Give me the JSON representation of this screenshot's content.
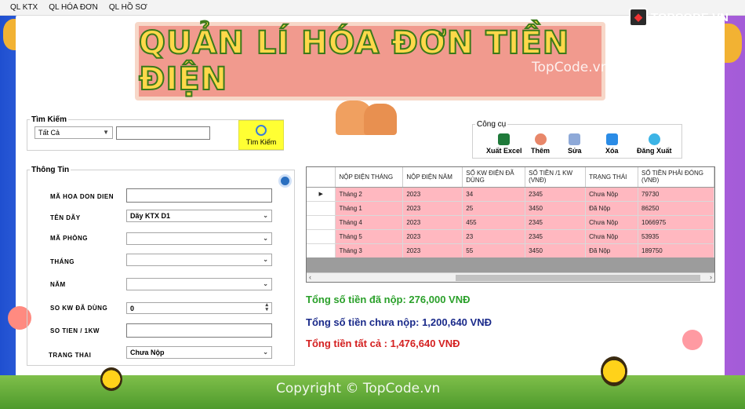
{
  "menu": [
    "QL KTX",
    "QL HÓA ĐƠN",
    "QL HỒ SƠ"
  ],
  "brand": "TOPCODE.VN",
  "title": "QUẢN LÍ HÓA ĐƠN TIỀN ĐIỆN",
  "watermark_top": "TopCode.vn",
  "watermark_bottom": "Copyright © TopCode.vn",
  "search": {
    "group_label": "Tìm Kiếm",
    "filter_value": "Tất Cả",
    "query": "",
    "button_label": "Tìm Kiếm"
  },
  "tools": {
    "group_label": "Công cụ",
    "export": "Xuất Excel",
    "add": "Thêm",
    "edit": "Sửa",
    "delete": "Xóa",
    "logout": "Đăng Xuất"
  },
  "info": {
    "group_label": "Thông Tin",
    "fields": {
      "invoice_id": {
        "label": "MÃ HOA DON DIEN",
        "value": ""
      },
      "building": {
        "label": "TÊN DÃY",
        "value": "Dãy KTX D1"
      },
      "room": {
        "label": "MÃ PHÒNG",
        "value": ""
      },
      "month": {
        "label": "THÁNG",
        "value": ""
      },
      "year": {
        "label": "NĂM",
        "value": ""
      },
      "kw_used": {
        "label": "SO KW ĐÃ DÙNG",
        "value": "0"
      },
      "price_per_kw": {
        "label": "SO TIEN / 1KW",
        "value": ""
      },
      "status": {
        "label": "TRANG THAI",
        "value": "Chưa Nộp"
      }
    }
  },
  "grid": {
    "headers": [
      "NỘP ĐIỆN THÁNG",
      "NỘP ĐIỆN NĂM",
      "SỐ KW ĐIỆN ĐÃ DÙNG",
      "SỐ TIỀN /1 KW (VNĐ)",
      "TRẠNG THÁI",
      "SỐ TIỀN PHẢI ĐÓNG (VNĐ)"
    ],
    "rows": [
      [
        "Tháng 2",
        "2023",
        "34",
        "2345",
        "Chưa Nộp",
        "79730"
      ],
      [
        "Tháng 1",
        "2023",
        "25",
        "3450",
        "Đã Nộp",
        "86250"
      ],
      [
        "Tháng 4",
        "2023",
        "455",
        "2345",
        "Chưa Nộp",
        "1066975"
      ],
      [
        "Tháng 5",
        "2023",
        "23",
        "2345",
        "Chưa Nộp",
        "53935"
      ],
      [
        "Tháng 3",
        "2023",
        "55",
        "3450",
        "Đã Nộp",
        "189750"
      ]
    ],
    "current_row_marker": "▶"
  },
  "totals": {
    "paid": "Tổng số tiền đã nộp: 276,000 VNĐ",
    "unpaid": "Tổng số tiền chưa nộp: 1,200,640 VNĐ",
    "all": "Tổng tiền tất cả : 1,476,640 VNĐ"
  },
  "colors": {
    "paid": "#2aa02a",
    "unpaid": "#1a2a8a",
    "all": "#d42020",
    "row_bg": "#ffb8c0",
    "search_button": "#ffff33"
  }
}
